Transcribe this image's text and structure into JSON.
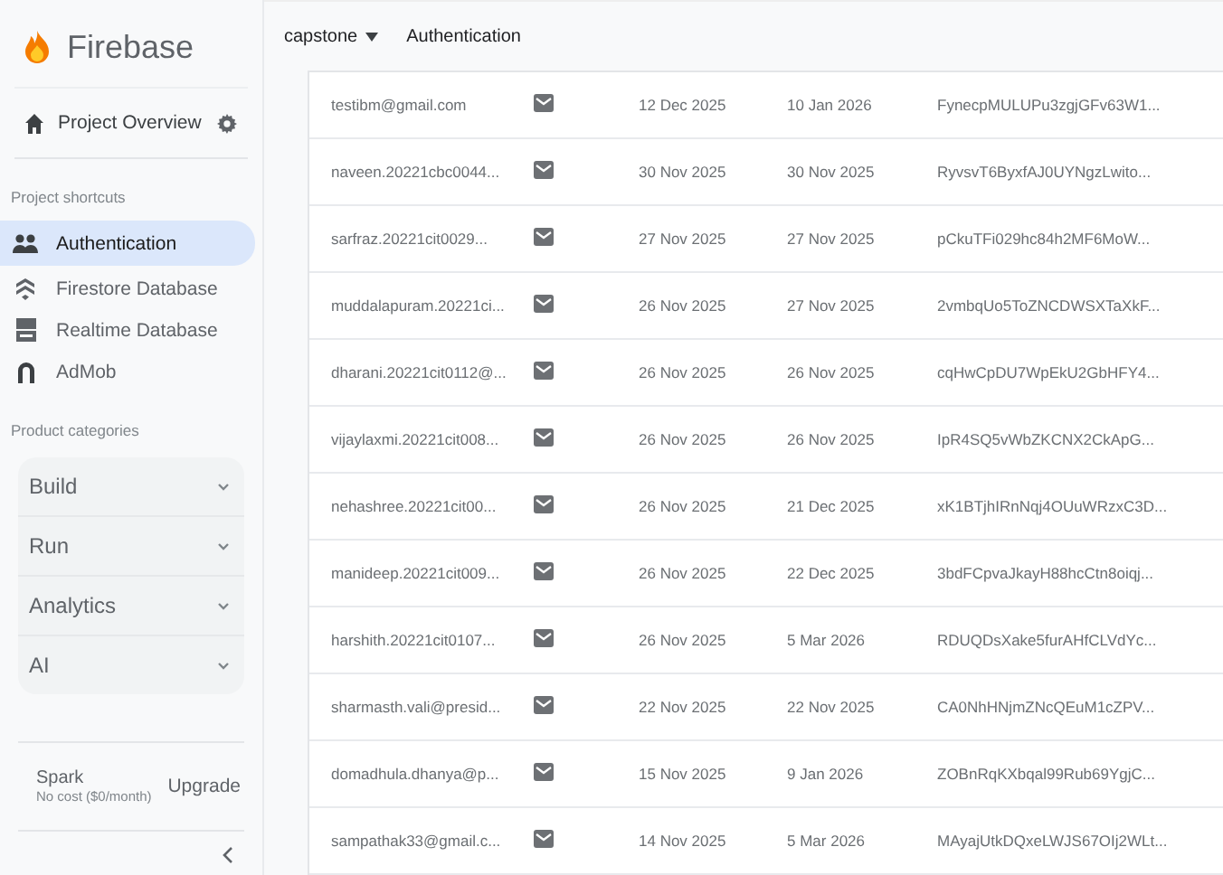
{
  "sidebar": {
    "brand": "Firebase",
    "overview": "Project Overview",
    "shortcuts_heading": "Project shortcuts",
    "shortcuts": [
      {
        "label": "Authentication",
        "selected": true
      },
      {
        "label": "Firestore Database",
        "selected": false
      },
      {
        "label": "Realtime Database",
        "selected": false
      },
      {
        "label": "AdMob",
        "selected": false
      }
    ],
    "categories_heading": "Product categories",
    "categories": [
      "Build",
      "Run",
      "Analytics",
      "AI"
    ],
    "plan": {
      "name": "Spark",
      "price": "No cost ($0/month)",
      "upgrade": "Upgrade"
    }
  },
  "header": {
    "project": "capstone",
    "page": "Authentication"
  },
  "table": {
    "rows": [
      {
        "email": "testibm@gmail.com",
        "created": "12 Dec 2025",
        "signed_in": "10 Jan 2026",
        "uid": "FynecpMULUPu3zgjGFv63W1..."
      },
      {
        "email": "naveen.20221cbc0044...",
        "created": "30 Nov 2025",
        "signed_in": "30 Nov 2025",
        "uid": "RyvsvT6ByxfAJ0UYNgzLwito..."
      },
      {
        "email": "sarfraz.20221cit0029...",
        "created": "27 Nov 2025",
        "signed_in": "27 Nov 2025",
        "uid": "pCkuTFi029hc84h2MF6MoW..."
      },
      {
        "email": "muddalapuram.20221ci...",
        "created": "26 Nov 2025",
        "signed_in": "27 Nov 2025",
        "uid": "2vmbqUo5ToZNCDWSXTaXkF..."
      },
      {
        "email": "dharani.20221cit0112@...",
        "created": "26 Nov 2025",
        "signed_in": "26 Nov 2025",
        "uid": "cqHwCpDU7WpEkU2GbHFY4..."
      },
      {
        "email": "vijaylaxmi.20221cit008...",
        "created": "26 Nov 2025",
        "signed_in": "26 Nov 2025",
        "uid": "IpR4SQ5vWbZKCNX2CkApG..."
      },
      {
        "email": "nehashree.20221cit00...",
        "created": "26 Nov 2025",
        "signed_in": "21 Dec 2025",
        "uid": "xK1BTjhIRnNqj4OUuWRzxC3D..."
      },
      {
        "email": "manideep.20221cit009...",
        "created": "26 Nov 2025",
        "signed_in": "22 Dec 2025",
        "uid": "3bdFCpvaJkayH88hcCtn8oiqj..."
      },
      {
        "email": "harshith.20221cit0107...",
        "created": "26 Nov 2025",
        "signed_in": "5 Mar 2026",
        "uid": "RDUQDsXake5furAHfCLVdYc..."
      },
      {
        "email": "sharmasth.vali@presid...",
        "created": "22 Nov 2025",
        "signed_in": "22 Nov 2025",
        "uid": "CA0NhHNjmZNcQEuM1cZPV..."
      },
      {
        "email": "domadhula.dhanya@p...",
        "created": "15 Nov 2025",
        "signed_in": "9 Jan 2026",
        "uid": "ZOBnRqKXbqal99Rub69YgjC..."
      },
      {
        "email": "sampathak33@gmail.c...",
        "created": "14 Nov 2025",
        "signed_in": "5 Mar 2026",
        "uid": "MAyajUtkDQxeLWJS67OIj2WLt..."
      }
    ]
  }
}
